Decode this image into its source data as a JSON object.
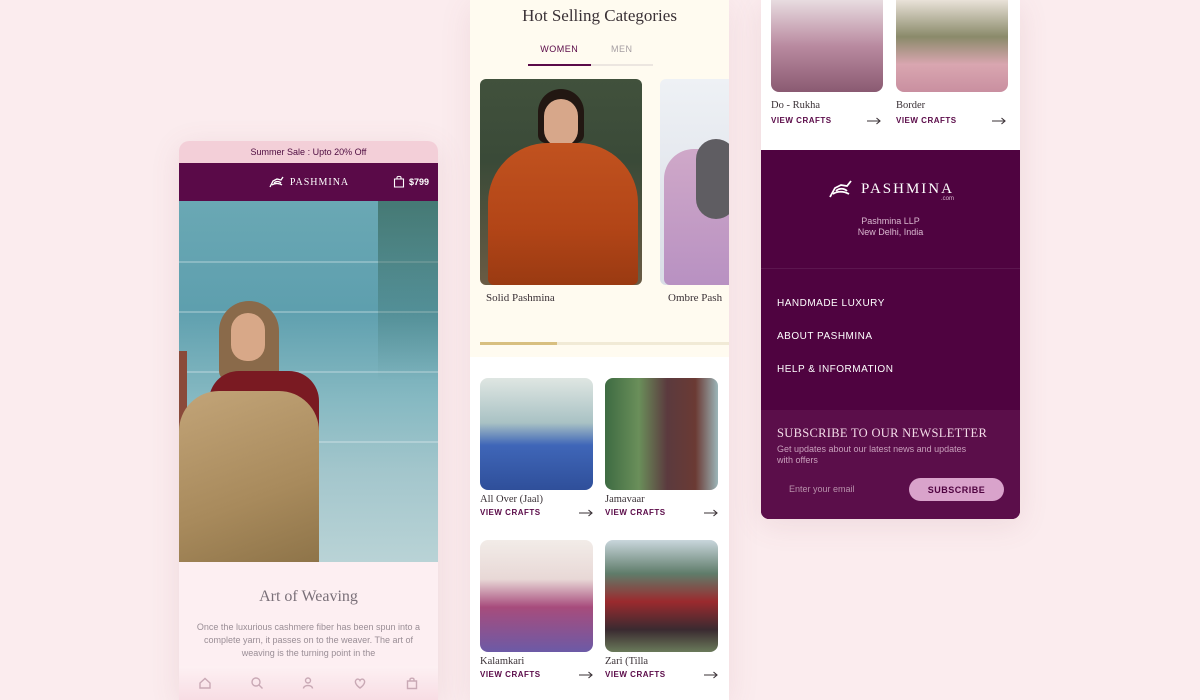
{
  "left_phone": {
    "promo_text": "Summer Sale : Upto 20% Off",
    "brand": "PASHMINA",
    "cart_amount": "$799",
    "section_title": "Art of Weaving",
    "section_text": "Once the luxurious cashmere fiber has been spun into a complete yarn, it passes on to the weaver. The art of weaving is the turning point in the",
    "bottom_nav": [
      "home-icon",
      "search-icon",
      "user-icon",
      "heart-icon",
      "bag-icon"
    ]
  },
  "middle_phone": {
    "title": "Hot Selling Categories",
    "tabs": [
      {
        "label": "WOMEN",
        "active": true
      },
      {
        "label": "MEN",
        "active": false
      }
    ],
    "carousel": [
      {
        "label": "Solid Pashmina",
        "color": "#b84a1a"
      },
      {
        "label": "Ombre Pash",
        "color": "#c6a0c6"
      }
    ],
    "carousel_progress": 0.31,
    "crafts": [
      {
        "name": "All Over (Jaal)",
        "cta": "VIEW CRAFTS",
        "color": "#3f66b8"
      },
      {
        "name": "Jamavaar",
        "cta": "VIEW CRAFTS",
        "color": "#5b3a3e"
      },
      {
        "name": "Kalamkari",
        "cta": "VIEW CRAFTS",
        "color": "#a74c7c"
      },
      {
        "name": "Zari (Tilla",
        "cta": "VIEW CRAFTS",
        "color": "#9b2a2e"
      }
    ]
  },
  "right_phone": {
    "crafts": [
      {
        "name": "Do - Rukha",
        "cta": "VIEW CRAFTS"
      },
      {
        "name": "Border",
        "cta": "VIEW CRAFTS"
      }
    ],
    "footer": {
      "brand": "PASHMINA",
      "brand_suffix": ".com",
      "company_line1": "Pashmina LLP",
      "company_line2": "New Delhi, India",
      "menu": [
        "HANDMADE LUXURY",
        "ABOUT PASHMINA",
        "HELP & INFORMATION"
      ],
      "newsletter_title": "SUBSCRIBE TO OUR NEWSLETTER",
      "newsletter_text": "Get updates about our latest news and updates with offers",
      "email_placeholder": "Enter your email",
      "subscribe_label": "SUBSCRIBE"
    }
  },
  "colors": {
    "brand_purple": "#5a0a48",
    "footer_purple": "#4f0340",
    "background": "#fbecee",
    "accent_gold": "#d8bf80",
    "subscribe_pink": "#d9a3cb"
  }
}
